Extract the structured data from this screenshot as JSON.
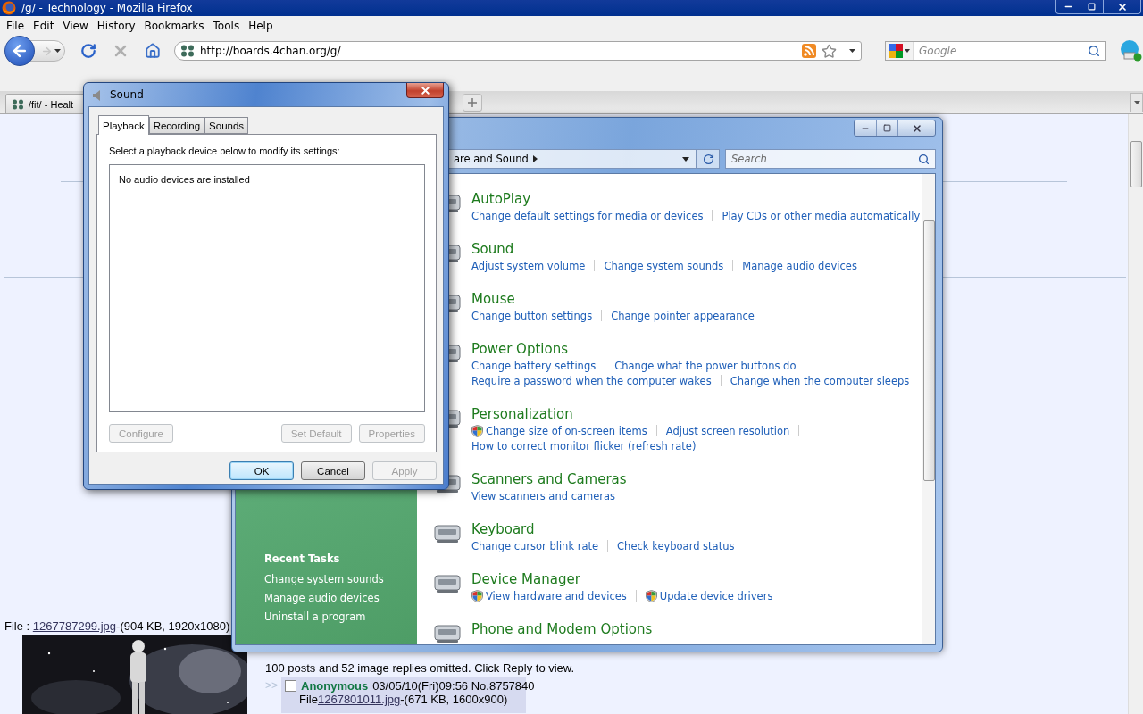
{
  "browser": {
    "title": "/g/ - Technology - Mozilla Firefox",
    "menu": [
      "File",
      "Edit",
      "View",
      "History",
      "Bookmarks",
      "Tools",
      "Help"
    ],
    "address": "http://boards.4chan.org/g/",
    "search_placeholder": "Google",
    "tabs": [
      {
        "label": "/fit/ - Healt",
        "selected": false
      }
    ]
  },
  "page": {
    "file": {
      "prefix": "File : ",
      "link": "1267787299.jpg",
      "suffix": "-(904 KB, 1920x1080)"
    },
    "omitted": "100 posts and 52 image replies omitted. Click Reply to view.",
    "quote_mark": ">>",
    "reply": {
      "checked": false,
      "name": "Anonymous",
      "date": "03/05/10(Fri)09:56 No.8757840",
      "file_prefix": "File",
      "link": "1267801011.jpg",
      "suffix": "-(671 KB, 1600x900)"
    }
  },
  "control_panel": {
    "breadcrumb": "are and Sound",
    "search_placeholder": "Search",
    "sidebar": {
      "heading": "Recent Tasks",
      "links": [
        "Change system sounds",
        "Manage audio devices",
        "Uninstall a program"
      ]
    },
    "sections": [
      {
        "title": "AutoPlay",
        "lines": [
          [
            {
              "text": "Change default settings for media or devices",
              "shield": false
            },
            {
              "text": "Play CDs or other media automatically",
              "shield": false
            }
          ]
        ]
      },
      {
        "title": "Sound",
        "lines": [
          [
            {
              "text": "Adjust system volume",
              "shield": false
            },
            {
              "text": "Change system sounds",
              "shield": false
            },
            {
              "text": "Manage audio devices",
              "shield": false
            }
          ]
        ]
      },
      {
        "title": "Mouse",
        "lines": [
          [
            {
              "text": "Change button settings",
              "shield": false
            },
            {
              "text": "Change pointer appearance",
              "shield": false
            }
          ]
        ]
      },
      {
        "title": "Power Options",
        "lines": [
          [
            {
              "text": "Change battery settings",
              "shield": false
            },
            {
              "text": "Change what the power buttons do",
              "shield": false
            }
          ],
          [
            {
              "text": "Require a password when the computer wakes",
              "shield": false
            },
            {
              "text": "Change when the computer sleeps",
              "shield": false
            }
          ]
        ]
      },
      {
        "title": "Personalization",
        "lines": [
          [
            {
              "text": "Change size of on-screen items",
              "shield": true
            },
            {
              "text": "Adjust screen resolution",
              "shield": false
            }
          ],
          [
            {
              "text": "How to correct monitor flicker (refresh rate)",
              "shield": false
            }
          ]
        ]
      },
      {
        "title": "Scanners and Cameras",
        "lines": [
          [
            {
              "text": "View scanners and cameras",
              "shield": false
            }
          ]
        ]
      },
      {
        "title": "Keyboard",
        "lines": [
          [
            {
              "text": "Change cursor blink rate",
              "shield": false
            },
            {
              "text": "Check keyboard status",
              "shield": false
            }
          ]
        ]
      },
      {
        "title": "Device Manager",
        "lines": [
          [
            {
              "text": "View hardware and devices",
              "shield": true
            },
            {
              "text": "Update device drivers",
              "shield": true
            }
          ]
        ]
      },
      {
        "title": "Phone and Modem Options"
      }
    ]
  },
  "dialog": {
    "title": "Sound",
    "tabs": [
      {
        "label": "Playback",
        "selected": true
      },
      {
        "label": "Recording",
        "selected": false
      },
      {
        "label": "Sounds",
        "selected": false
      }
    ],
    "instruction": "Select a playback device below to modify its settings:",
    "empty_message": "No audio devices are installed",
    "device_buttons": [
      {
        "label": "Configure",
        "disabled": true
      },
      {
        "label": "Set Default",
        "disabled": true
      },
      {
        "label": "Properties",
        "disabled": true
      }
    ],
    "footer_buttons": [
      {
        "label": "OK",
        "disabled": false,
        "default": true
      },
      {
        "label": "Cancel",
        "disabled": false,
        "default": false
      },
      {
        "label": "Apply",
        "disabled": true,
        "default": false
      }
    ]
  }
}
